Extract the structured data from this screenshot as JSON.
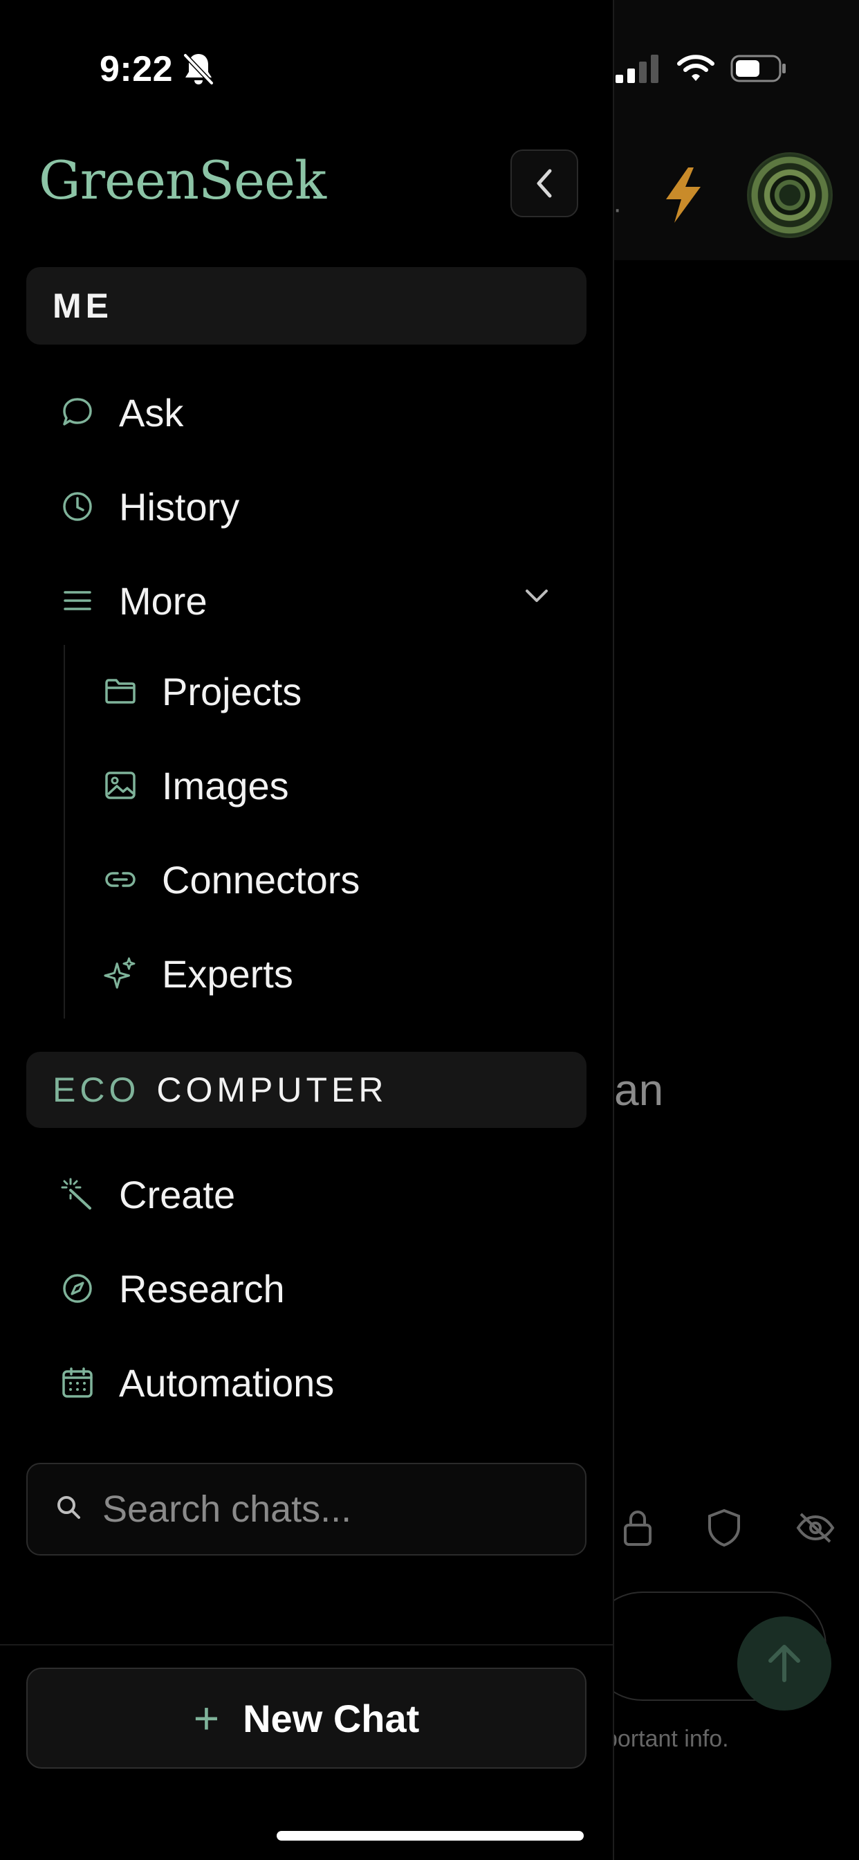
{
  "status_bar": {
    "time": "9:22"
  },
  "app": {
    "logo": "GreenSeek",
    "accent_color": "#7fb39a"
  },
  "drawer": {
    "me_header": "ME",
    "me_items": [
      {
        "label": "Ask",
        "icon": "chat-bubble-icon"
      },
      {
        "label": "History",
        "icon": "clock-icon"
      },
      {
        "label": "More",
        "icon": "menu-lines-icon"
      }
    ],
    "more_subitems": [
      {
        "label": "Projects",
        "icon": "folder-icon"
      },
      {
        "label": "Images",
        "icon": "image-icon"
      },
      {
        "label": "Connectors",
        "icon": "link-icon"
      },
      {
        "label": "Experts",
        "icon": "sparkles-icon"
      }
    ],
    "eco_header": {
      "eco": "ECO",
      "computer": "COMPUTER"
    },
    "eco_items": [
      {
        "label": "Create",
        "icon": "magic-wand-icon"
      },
      {
        "label": "Research",
        "icon": "compass-icon"
      },
      {
        "label": "Automations",
        "icon": "calendar-icon"
      }
    ],
    "search": {
      "placeholder": "Search chats..."
    },
    "new_chat_label": "New Chat"
  },
  "background": {
    "partial_text": "an",
    "footnote": "portant info."
  }
}
